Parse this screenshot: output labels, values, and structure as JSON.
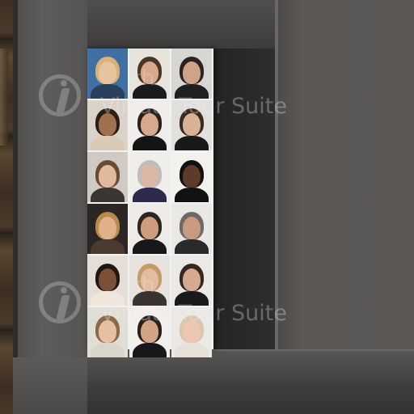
{
  "watermarks": [
    {
      "line1": "th",
      "line2": "Virtual Tour Suite"
    },
    {
      "line1": "th",
      "line2": "Virtual Tour Suite"
    }
  ],
  "colors": {
    "wall": "#5a5755",
    "back_wall": "#353433",
    "board": "#f2f1ef",
    "shelf_wood": "#4a3b2b"
  },
  "photos": [
    {
      "bg": "#3f6fa3",
      "hair": "#d9b27a",
      "skin": "#e8c3a0",
      "body": "#2a3f5c"
    },
    {
      "bg": "#e7e4de",
      "hair": "#4a3626",
      "skin": "#d7a889",
      "body": "#1b1b1d"
    },
    {
      "bg": "#d8d6d2",
      "hair": "#2a2420",
      "skin": "#cfa386",
      "body": "#202022"
    },
    {
      "bg": "#d9d3ca",
      "hair": "#2b1e17",
      "skin": "#a0704f",
      "body": "#d9cbb3"
    },
    {
      "bg": "#efeeec",
      "hair": "#2a211b",
      "skin": "#d6a98c",
      "body": "#151516"
    },
    {
      "bg": "#e2e0dc",
      "hair": "#3a2a20",
      "skin": "#d9b295",
      "body": "#19191b"
    },
    {
      "bg": "#cfcac3",
      "hair": "#6a4a32",
      "skin": "#e1b99c",
      "body": "#3c3633"
    },
    {
      "bg": "#efeeeb",
      "hair": "#bdbdbd",
      "skin": "#dcb7a3",
      "body": "#2e2a4c"
    },
    {
      "bg": "#f2f1ee",
      "hair": "#111111",
      "skin": "#5e3b28",
      "body": "#121212"
    },
    {
      "bg": "#2b2623",
      "hair": "#b88a4f",
      "skin": "#e0b089",
      "body": "#4a3a2f"
    },
    {
      "bg": "#ecebe8",
      "hair": "#2d2620",
      "skin": "#cf9c7d",
      "body": "#18181a"
    },
    {
      "bg": "#e9e8e4",
      "hair": "#6d6a66",
      "skin": "#c89b7e",
      "body": "#2a2a2d"
    },
    {
      "bg": "#e4ded7",
      "hair": "#201713",
      "skin": "#7a5038",
      "body": "#efe7dc"
    },
    {
      "bg": "#e6e3de",
      "hair": "#c49a6a",
      "skin": "#e3bd9d",
      "body": "#3a3330"
    },
    {
      "bg": "#eae9e6",
      "hair": "#352820",
      "skin": "#d7aa8f",
      "body": "#1a1a1c"
    },
    {
      "bg": "#e1ddd7",
      "hair": "#8a6a4a",
      "skin": "#e6c0a0",
      "body": "#d9d4cc"
    },
    {
      "bg": "#f0efec",
      "hair": "#2a201a",
      "skin": "#d4a385",
      "body": "#18181a"
    },
    {
      "bg": "#ebe9e5",
      "hair": "#d8c7ae",
      "skin": "#ecc8b0",
      "body": "#e6e0d8"
    }
  ]
}
